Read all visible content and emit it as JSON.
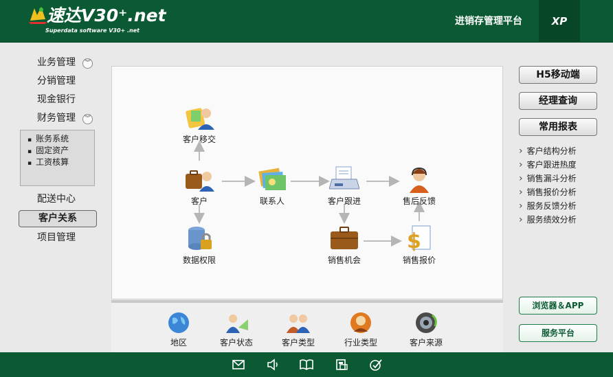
{
  "header": {
    "brand_title": "速达V30⁺.net",
    "brand_subtitle": "Superdata software V30+ .net",
    "platform_label": "进销存管理平台",
    "edition_label": "XP"
  },
  "left_nav": {
    "items": [
      {
        "label": "业务管理",
        "expand_icon": "chevron-down-icon"
      },
      {
        "label": "分销管理"
      },
      {
        "label": "现金银行"
      },
      {
        "label": "财务管理",
        "expand_icon": "chevron-down-icon"
      }
    ],
    "finance_sub_items": [
      "账务系统",
      "固定资产",
      "工资核算"
    ],
    "items_after": [
      {
        "label": "配送中心"
      },
      {
        "label": "客户关系",
        "active": true
      },
      {
        "label": "项目管理"
      }
    ]
  },
  "diagram": {
    "nodes": {
      "customer_transfer": "客户移交",
      "customer": "客户",
      "contact": "联系人",
      "customer_followup": "客户跟进",
      "after_sales": "售后反馈",
      "data_permission": "数据权限",
      "sales_opportunity": "销售机会",
      "sales_quote": "销售报价"
    }
  },
  "bottom_bar": {
    "items": [
      {
        "label": "地区",
        "icon": "globe-icon"
      },
      {
        "label": "客户状态",
        "icon": "customer-status-icon"
      },
      {
        "label": "客户类型",
        "icon": "customer-type-icon"
      },
      {
        "label": "行业类型",
        "icon": "industry-icon"
      },
      {
        "label": "客户来源",
        "icon": "camera-icon"
      }
    ]
  },
  "right_panel": {
    "buttons": [
      "H5移动端",
      "经理查询",
      "常用报表"
    ],
    "reports": [
      "客户结构分析",
      "客户跟进热度",
      "销售漏斗分析",
      "销售报价分析",
      "服务反馈分析",
      "服务绩效分析"
    ],
    "browser_app_label": "浏览器＆APP",
    "service_platform_label": "服务平台"
  },
  "footer": {
    "icons": [
      "mail-icon",
      "speaker-icon",
      "book-icon",
      "calculator-icon",
      "check-icon"
    ]
  },
  "colors": {
    "brand_green": "#0b5a33",
    "dark_green": "#074728",
    "panel_gray": "#dcdcdc"
  }
}
